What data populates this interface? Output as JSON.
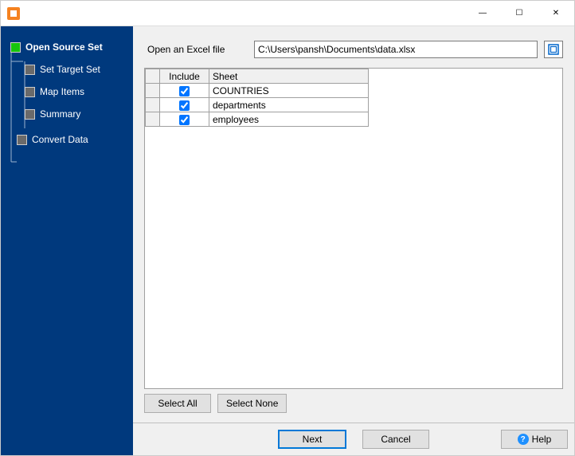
{
  "window": {
    "minimize": "—",
    "maximize": "☐",
    "close": "✕"
  },
  "sidebar": {
    "items": [
      {
        "label": "Open Source Set",
        "level": 1,
        "active": true
      },
      {
        "label": "Set Target Set",
        "level": 2,
        "active": false
      },
      {
        "label": "Map Items",
        "level": 2,
        "active": false
      },
      {
        "label": "Summary",
        "level": 2,
        "active": false
      },
      {
        "label": "Convert Data",
        "level": 1,
        "active": false
      }
    ]
  },
  "file_row": {
    "label": "Open an Excel file",
    "path": "C:\\Users\\pansh\\Documents\\data.xlsx"
  },
  "table": {
    "headers": {
      "include": "Include",
      "sheet": "Sheet"
    },
    "rows": [
      {
        "include": true,
        "sheet": "COUNTRIES"
      },
      {
        "include": true,
        "sheet": "departments"
      },
      {
        "include": true,
        "sheet": "employees"
      }
    ]
  },
  "buttons": {
    "select_all": "Select All",
    "select_none": "Select None",
    "next": "Next",
    "cancel": "Cancel",
    "help": "Help"
  }
}
